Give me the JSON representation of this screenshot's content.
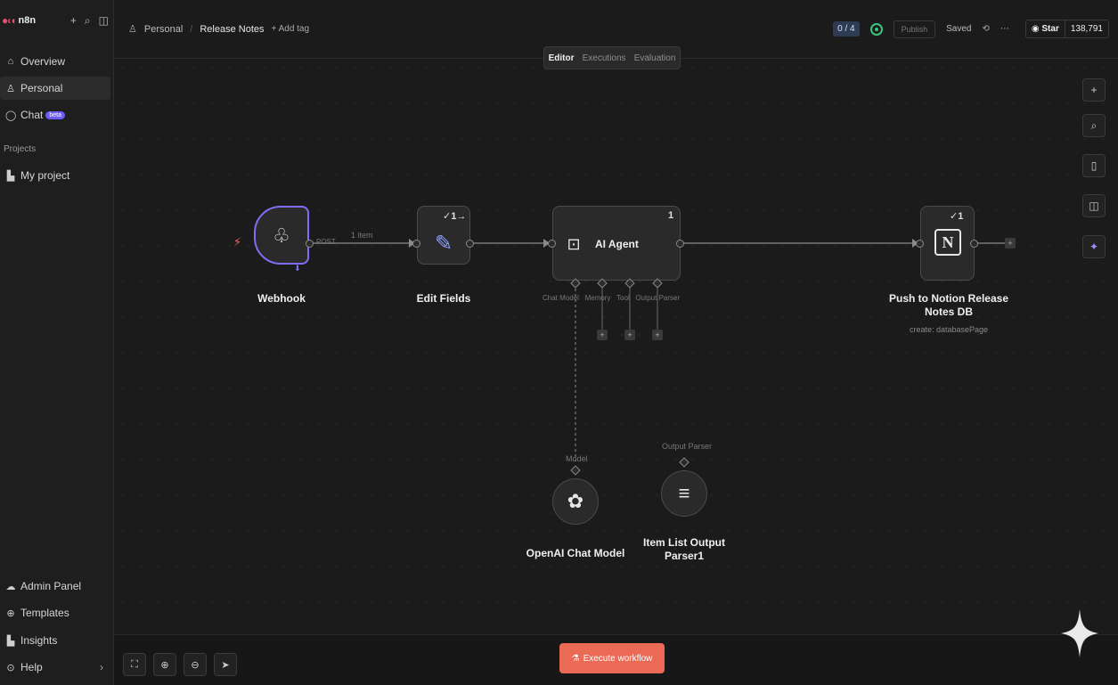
{
  "sidebar": {
    "logo": "n8n",
    "items": [
      {
        "label": "Overview",
        "icon": "home-icon"
      },
      {
        "label": "Personal",
        "icon": "user-icon"
      },
      {
        "label": "Chat",
        "icon": "chat-icon",
        "badge": "beta"
      }
    ],
    "section_label": "Projects",
    "project": {
      "label": "My project",
      "icon": "chart-icon"
    },
    "bottom_items": [
      {
        "label": "Admin Panel",
        "icon": "cloud-icon"
      },
      {
        "label": "Templates",
        "icon": "globe-icon"
      },
      {
        "label": "Insights",
        "icon": "chart-icon"
      },
      {
        "label": "Help",
        "icon": "help-icon"
      }
    ]
  },
  "header": {
    "breadcrumb_owner": "Personal",
    "workflow_name": "Release Notes",
    "add_tag": "+ Add tag",
    "counter": "0 / 4",
    "publish": "Publish",
    "saved": "Saved",
    "github_star": "Star",
    "github_count": "138,791"
  },
  "tabs": [
    "Editor",
    "Executions",
    "Evaluation"
  ],
  "nodes": {
    "webhook": {
      "label": "Webhook",
      "port_label": "POST"
    },
    "edge_label": "1 item",
    "edit_fields": {
      "label": "Edit Fields",
      "count": "1"
    },
    "ai_agent": {
      "label": "AI Agent",
      "count": "1",
      "ports": "Chat Model   Memory   Tool   Output Parser"
    },
    "notion": {
      "label_line1": "Push to Notion Release",
      "label_line2": "Notes DB",
      "sub": "create: databasePage",
      "count": "1"
    },
    "openai": {
      "label": "OpenAI Chat Model",
      "port_label": "Model"
    },
    "parser": {
      "label_line1": "Item List Output",
      "label_line2": "Parser1",
      "port_label": "Output Parser"
    }
  },
  "bottom": {
    "execute_label": "Execute workflow"
  },
  "colors": {
    "accent": "#ea4b71",
    "execute": "#ea6a55",
    "active": "#3bc77b",
    "trigger_border": "#7c6ff2",
    "sparkle": "#7c6ff2"
  }
}
